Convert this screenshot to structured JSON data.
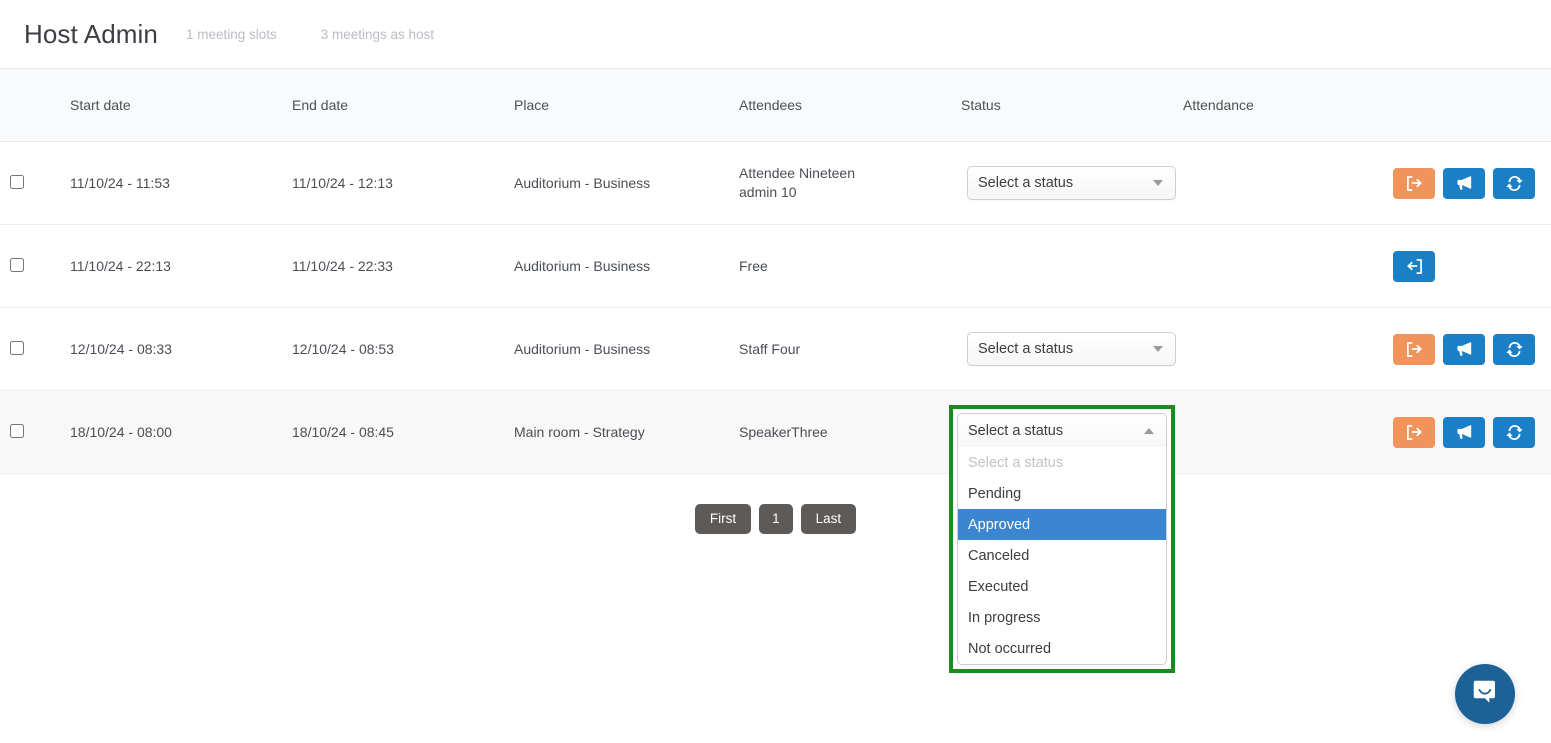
{
  "header": {
    "title": "Host Admin",
    "meta_slots": "1 meeting slots",
    "meta_host": "3 meetings as host"
  },
  "table": {
    "columns": [
      "Start date",
      "End date",
      "Place",
      "Attendees",
      "Status",
      "Attendance"
    ],
    "rows": [
      {
        "start": "11/10/24 - 11:53",
        "end": "11/10/24 - 12:13",
        "place": "Auditorium - Business",
        "attendee_line1": "Attendee Nineteen",
        "attendee_line2": "admin 10",
        "status_label": "Select a status",
        "has_status_select": true,
        "attendance": "",
        "actions": [
          "sign-out-icon",
          "bullhorn-icon",
          "refresh-icon"
        ]
      },
      {
        "start": "11/10/24 - 22:13",
        "end": "11/10/24 - 22:33",
        "place": "Auditorium - Business",
        "attendee_line1": "Free",
        "attendee_line2": "",
        "status_label": "",
        "has_status_select": false,
        "attendance": "",
        "actions": [
          "sign-in-icon"
        ]
      },
      {
        "start": "12/10/24 - 08:33",
        "end": "12/10/24 - 08:53",
        "place": "Auditorium - Business",
        "attendee_line1": "Staff Four",
        "attendee_line2": "",
        "status_label": "Select a status",
        "has_status_select": true,
        "attendance": "",
        "actions": [
          "sign-out-icon",
          "bullhorn-icon",
          "refresh-icon"
        ]
      },
      {
        "start": "18/10/24 - 08:00",
        "end": "18/10/24 - 08:45",
        "place": "Main room - Strategy",
        "attendee_line1": "SpeakerThree",
        "attendee_line2": "",
        "status_label": "Select a status",
        "has_status_select": false,
        "attendance": "",
        "actions": [
          "sign-out-icon",
          "bullhorn-icon",
          "refresh-icon"
        ]
      }
    ]
  },
  "dropdown": {
    "trigger_label": "Select a status",
    "options": [
      {
        "label": "Select a status",
        "state": "disabled"
      },
      {
        "label": "Pending",
        "state": "normal"
      },
      {
        "label": "Approved",
        "state": "selected"
      },
      {
        "label": "Canceled",
        "state": "normal"
      },
      {
        "label": "Executed",
        "state": "normal"
      },
      {
        "label": "In progress",
        "state": "normal"
      },
      {
        "label": "Not occurred",
        "state": "normal"
      }
    ],
    "highlight_color": "#1e8a1e",
    "selected_color": "#3b86d0"
  },
  "pagination": {
    "first": "First",
    "page": "1",
    "last": "Last"
  },
  "chat": {
    "icon": "chat-bubble-icon",
    "color": "#1d6296"
  },
  "colors": {
    "action_orange": "#f0945c",
    "action_blue": "#1a7fc4",
    "page_button": "#5d5a57"
  }
}
